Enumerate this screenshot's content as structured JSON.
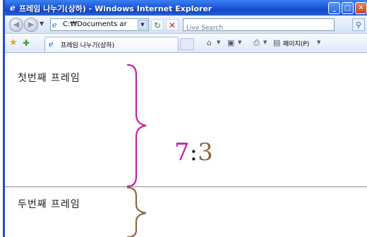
{
  "window": {
    "title": "프레임 나누기(상하) - Windows Internet Explorer",
    "minimize_glyph": "_",
    "maximize_glyph": "□",
    "close_glyph": "✕"
  },
  "address_bar": {
    "url": "C:₩Documents ar",
    "search_placeholder": "Live Search"
  },
  "command_bar": {
    "tab_label": "프레임 나누기(상하)",
    "page_menu_label": "페이지(P)"
  },
  "frames": {
    "top_label": "첫번째 프레임",
    "bottom_label": "두번째 프레임"
  },
  "annotation": {
    "ratio_a": "7",
    "ratio_sep": ":",
    "ratio_b": "3",
    "colors": {
      "ratio_a": "#c2259e",
      "ratio_b": "#8a6c3c",
      "brace_top": "#c2259e",
      "brace_bottom": "#8a6c3c"
    }
  },
  "icons": {
    "app": "ie-icon",
    "back": "back-arrow-icon",
    "forward": "forward-arrow-icon",
    "refresh": "refresh-icon",
    "stop": "stop-icon",
    "search": "search-icon",
    "favorites": "favorites-star-icon",
    "add_favorite": "add-favorite-icon",
    "home": "home-icon",
    "feeds": "feeds-icon",
    "print": "print-icon",
    "page": "page-icon"
  }
}
